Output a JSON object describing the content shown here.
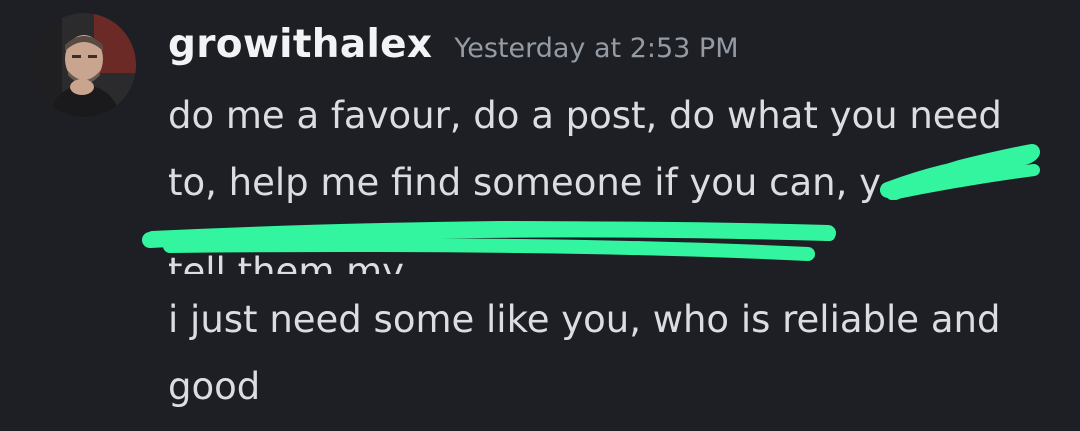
{
  "message": {
    "author": "growithalex",
    "timestamp": "Yesterday at 2:53 PM",
    "lines": [
      "do me a favour, do a post, do what you need",
      "to, help me find someone if you can, y",
      "tell them my ",
      "i just need some like you, who is reliable and",
      "good"
    ]
  },
  "colors": {
    "background": "#1e1f24",
    "username": "#f2f3f5",
    "timestamp": "#949ba4",
    "text": "#dbdee1",
    "redaction": "#33f5a0"
  },
  "icons": {
    "avatar": "user-photo-avatar"
  }
}
